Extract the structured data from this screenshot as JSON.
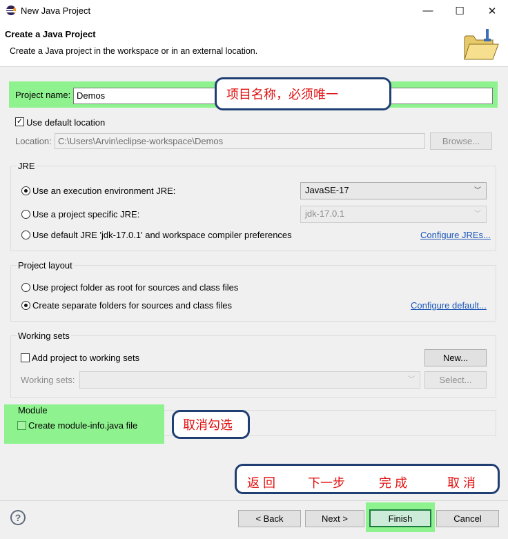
{
  "window": {
    "title": "New Java Project",
    "controls": {
      "minimize": "—",
      "maximize": "☐",
      "close": "✕"
    }
  },
  "header": {
    "title": "Create a Java Project",
    "description": "Create a Java project in the workspace or in an external location."
  },
  "project": {
    "name_label": "Project name:",
    "name_value": "Demos"
  },
  "location": {
    "use_default_label": "Use default location",
    "use_default_checked": true,
    "label": "Location:",
    "value": "C:\\Users\\Arvin\\eclipse-workspace\\Demos",
    "browse_label": "Browse..."
  },
  "jre": {
    "group_label": "JRE",
    "options": [
      {
        "label": "Use an execution environment JRE:",
        "selected": true,
        "combo": "JavaSE-17"
      },
      {
        "label": "Use a project specific JRE:",
        "selected": false,
        "combo": "jdk-17.0.1"
      },
      {
        "label": "Use default JRE 'jdk-17.0.1' and workspace compiler preferences",
        "selected": false
      }
    ],
    "configure_link": "Configure JREs..."
  },
  "layout": {
    "group_label": "Project layout",
    "options": [
      {
        "label": "Use project folder as root for sources and class files",
        "selected": false
      },
      {
        "label": "Create separate folders for sources and class files",
        "selected": true
      }
    ],
    "configure_link": "Configure default..."
  },
  "working_sets": {
    "group_label": "Working sets",
    "add_label": "Add project to working sets",
    "add_checked": false,
    "new_label": "New...",
    "sets_label": "Working sets:",
    "select_label": "Select..."
  },
  "module": {
    "group_label": "Module",
    "create_label": "Create module-info.java file",
    "create_checked": false
  },
  "annotations": {
    "project_name_note": "项目名称，必须唯一",
    "module_note": "取消勾选",
    "buttons_note": [
      "返 回",
      "下一步",
      "完 成",
      "取 消"
    ]
  },
  "footer": {
    "help_icon": "?",
    "back_label": "< Back",
    "next_label": "Next >",
    "finish_label": "Finish",
    "cancel_label": "Cancel"
  },
  "colors": {
    "highlight": "#8ef28e",
    "annotation_text": "#e01010",
    "annotation_border": "#1f3f73",
    "link": "#1a55b8"
  }
}
